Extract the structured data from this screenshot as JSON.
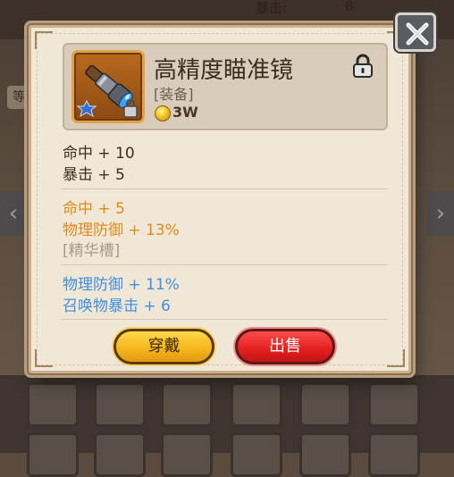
{
  "background": {
    "stats": [
      {
        "label": "暴击:",
        "value": "8"
      }
    ],
    "side_label": "等"
  },
  "item": {
    "name": "高精度瞄准镜",
    "type": "[装备]",
    "price": "3W",
    "icon": "spyglass-icon",
    "locked": true
  },
  "base_stats": [
    "命中 + 10",
    "暴击 + 5"
  ],
  "extra_stats": [
    "命中 + 5",
    "物理防御 + 13%"
  ],
  "socket_label": "[精华槽]",
  "essence_stats": [
    "物理防御 + 11%",
    "召唤物暴击 + 6"
  ],
  "buttons": {
    "equip": "穿戴",
    "sell": "出售"
  },
  "colors": {
    "extra_stat": "#e08a1e",
    "essence_stat": "#3e8fe0",
    "socket": "#a69a8e",
    "equip_button": "#f4b41a",
    "sell_button": "#e21f1f"
  }
}
